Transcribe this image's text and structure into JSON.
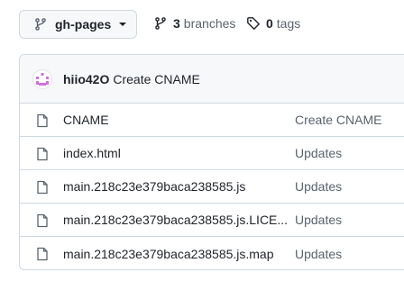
{
  "branch": {
    "name": "gh-pages"
  },
  "meta": {
    "branches_count": "3",
    "branches_label": "branches",
    "tags_count": "0",
    "tags_label": "tags"
  },
  "commit": {
    "author": "hiio42O",
    "message": "Create CNAME"
  },
  "files": [
    {
      "name": "CNAME",
      "message": "Create CNAME"
    },
    {
      "name": "index.html",
      "message": "Updates"
    },
    {
      "name": "main.218c23e379baca238585.js",
      "message": "Updates"
    },
    {
      "name": "main.218c23e379baca238585.js.LICE...",
      "message": "Updates"
    },
    {
      "name": "main.218c23e379baca238585.js.map",
      "message": "Updates"
    }
  ]
}
